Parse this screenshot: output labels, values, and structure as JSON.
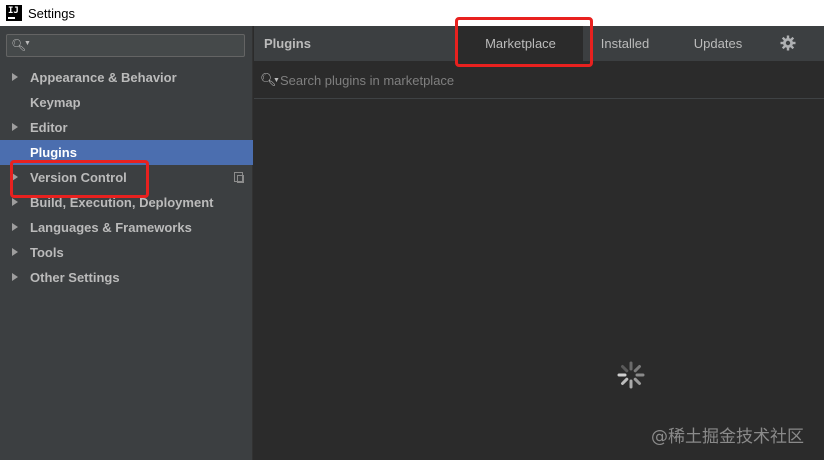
{
  "window": {
    "title": "Settings",
    "icon": "intellij-idea-icon"
  },
  "sidebar": {
    "search": {
      "value": "",
      "placeholder": ""
    },
    "items": [
      {
        "label": "Appearance & Behavior",
        "expandable": true
      },
      {
        "label": "Keymap",
        "expandable": false
      },
      {
        "label": "Editor",
        "expandable": true
      },
      {
        "label": "Plugins",
        "expandable": false,
        "selected": true
      },
      {
        "label": "Version Control",
        "expandable": true
      },
      {
        "label": "Build, Execution, Deployment",
        "expandable": true
      },
      {
        "label": "Languages & Frameworks",
        "expandable": true
      },
      {
        "label": "Tools",
        "expandable": true
      },
      {
        "label": "Other Settings",
        "expandable": true
      }
    ]
  },
  "main": {
    "title": "Plugins",
    "tabs": [
      {
        "label": "Marketplace",
        "active": true
      },
      {
        "label": "Installed",
        "active": false
      },
      {
        "label": "Updates",
        "active": false
      }
    ],
    "search": {
      "value": "",
      "placeholder": "Search plugins in marketplace"
    },
    "loading": true
  },
  "watermark": "@稀土掘金技术社区",
  "colors": {
    "sidebar_bg": "#3c3f41",
    "main_bg": "#2b2b2b",
    "selection": "#4b6eaf",
    "text": "#bbbbbb",
    "annotation_red": "#e8211f"
  }
}
